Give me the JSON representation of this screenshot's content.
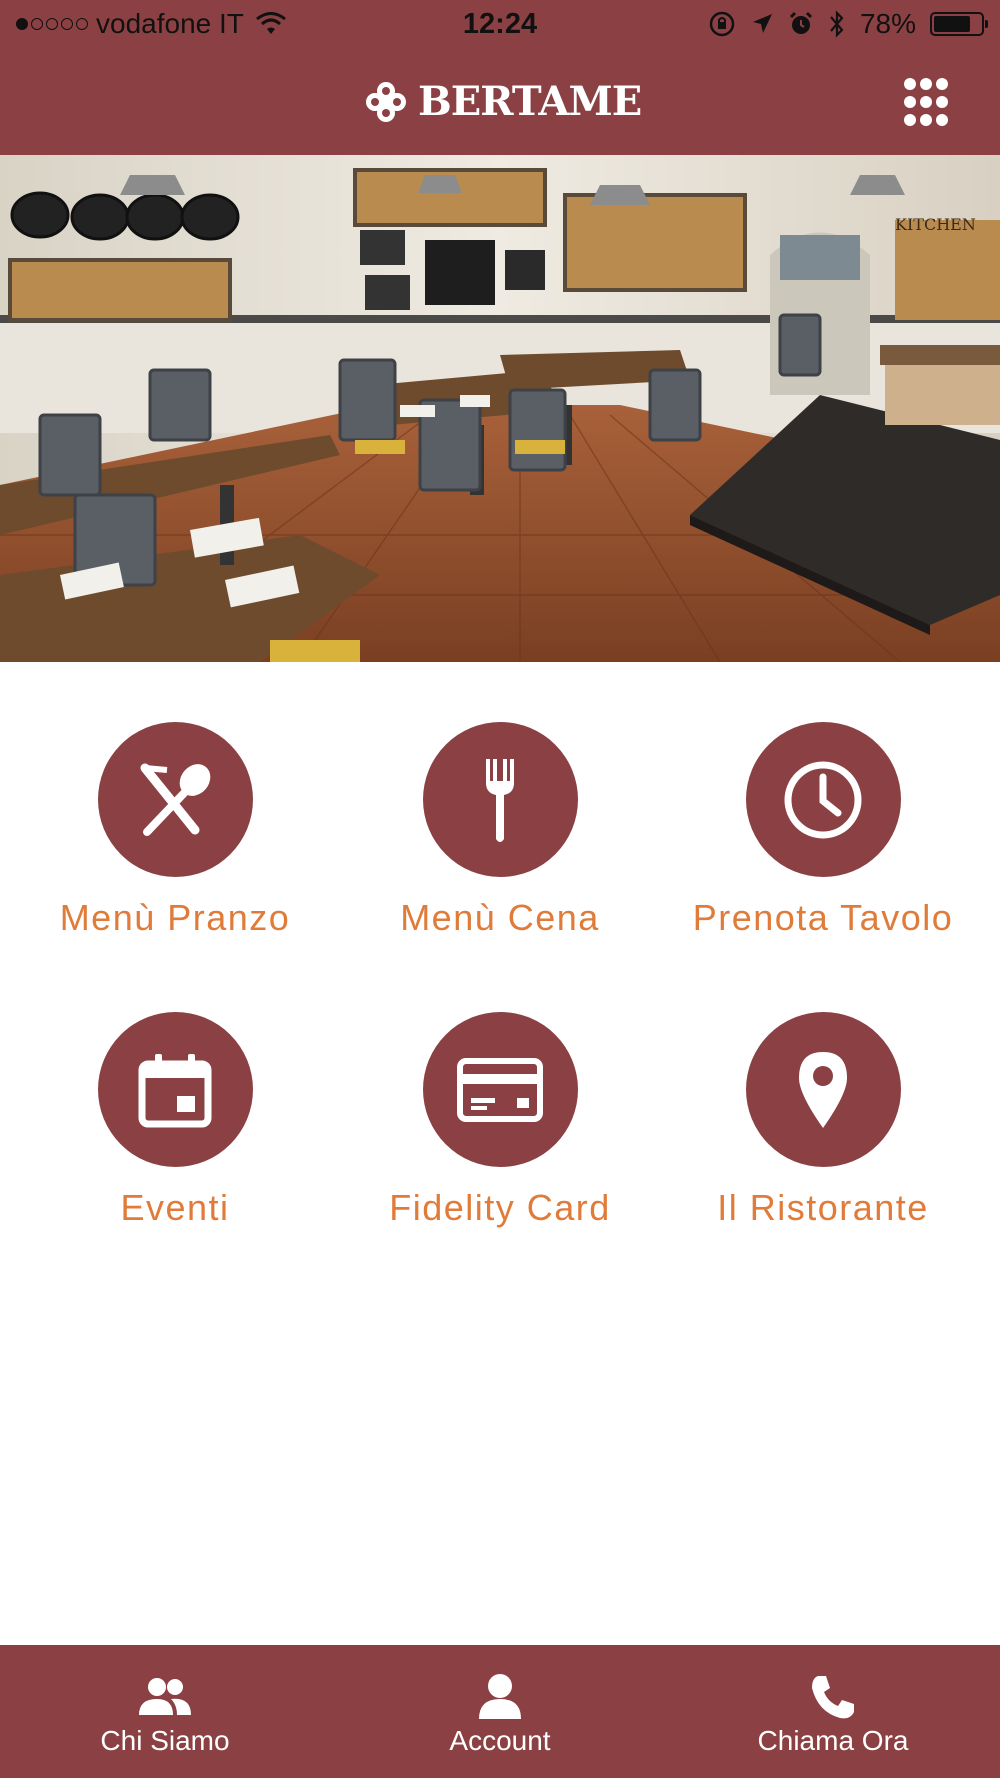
{
  "status_bar": {
    "carrier": "vodafone IT",
    "time": "12:24",
    "battery_percent": "78%",
    "battery_level": 0.78,
    "signal_bars_filled": 1,
    "signal_bars_total": 5
  },
  "header": {
    "logo_text": "BERTAME",
    "menu_icon": "grid-menu-icon"
  },
  "colors": {
    "brand": "#8b4143",
    "accent": "#e07b39",
    "background": "#ffffff"
  },
  "tiles": [
    {
      "label": "Menù Pranzo",
      "icon": "cutlery-cross-icon"
    },
    {
      "label": "Menù Cena",
      "icon": "fork-icon"
    },
    {
      "label": "Prenota Tavolo",
      "icon": "clock-icon"
    },
    {
      "label": "Eventi",
      "icon": "calendar-icon"
    },
    {
      "label": "Fidelity Card",
      "icon": "credit-card-icon"
    },
    {
      "label": "Il Ristorante",
      "icon": "location-pin-icon"
    }
  ],
  "bottom_nav": [
    {
      "label": "Chi Siamo",
      "icon": "people-icon"
    },
    {
      "label": "Account",
      "icon": "person-icon"
    },
    {
      "label": "Chiama Ora",
      "icon": "phone-icon"
    }
  ],
  "hero": {
    "sign_text": "KITCHEN"
  }
}
